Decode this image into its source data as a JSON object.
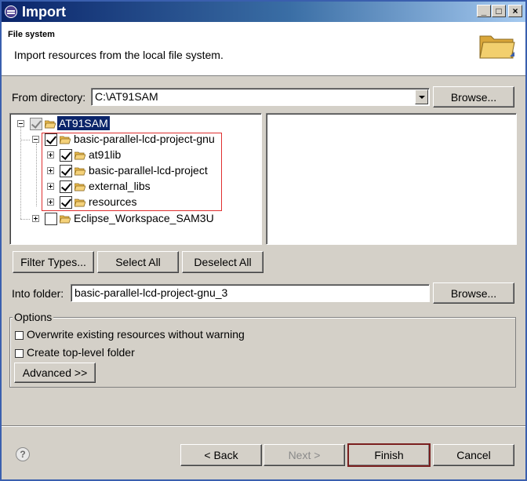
{
  "window": {
    "title": "Import",
    "controls": {
      "minimize": "_",
      "maximize": "□",
      "close": "×"
    }
  },
  "header": {
    "title": "File system",
    "description": "Import resources from the local file system.",
    "icon": "folder-icon"
  },
  "from_directory": {
    "label": "From directory:",
    "value": "C:\\AT91SAM",
    "browse_label": "Browse..."
  },
  "tree": {
    "root": {
      "label": "AT91SAM",
      "checked": true,
      "greyed": true
    },
    "project": {
      "label": "basic-parallel-lcd-project-gnu",
      "checked": true
    },
    "children": [
      {
        "label": "at91lib",
        "checked": true
      },
      {
        "label": "basic-parallel-lcd-project",
        "checked": true
      },
      {
        "label": "external_libs",
        "checked": true
      },
      {
        "label": "resources",
        "checked": true
      }
    ],
    "other": {
      "label": "Eclipse_Workspace_SAM3U",
      "checked": false
    }
  },
  "selection_buttons": {
    "filter_types": "Filter Types...",
    "select_all": "Select All",
    "deselect_all": "Deselect All"
  },
  "into_folder": {
    "label": "Into folder:",
    "value": "basic-parallel-lcd-project-gnu_3",
    "browse_label": "Browse..."
  },
  "options": {
    "label": "Options",
    "overwrite": {
      "label": "Overwrite existing resources without warning",
      "checked": false
    },
    "create_top_level": {
      "label": "Create top-level folder",
      "checked": false
    },
    "advanced_label": "Advanced >>"
  },
  "footer": {
    "back": "< Back",
    "next": "Next >",
    "finish": "Finish",
    "cancel": "Cancel"
  },
  "colors": {
    "title_gradient_start": "#0a246a",
    "selection": "#0a246a",
    "highlight_box": "#e03030",
    "folder": "#e8b84a"
  }
}
